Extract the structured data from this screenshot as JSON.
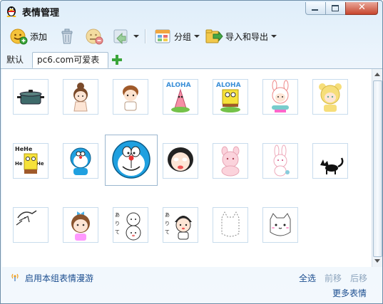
{
  "window": {
    "title": "表情管理"
  },
  "toolbar": {
    "add_label": "添加",
    "group_label": "分组",
    "import_export_label": "导入和导出"
  },
  "tabs": [
    {
      "label": "默认"
    },
    {
      "label": "pc6.com可爱表情"
    }
  ],
  "emoticons": [
    "pot",
    "girl-bun",
    "boy-brown-hair",
    "patrick-aloha",
    "spongebob-aloha",
    "bunny-hat-girl",
    "yellow-bear-girl",
    "spongebob-hehe",
    "doraemon-small",
    "doraemon-big",
    "crying-face",
    "pink-bunny",
    "pink-rabbit",
    "black-cat",
    "sketch-cat",
    "blue-bow-girl",
    "bald-baby-text",
    "girl-text",
    "white-cat-outline",
    "white-cat-cute"
  ],
  "footer": {
    "roam_label": "启用本组表情漫游",
    "select_all": "全选",
    "move_forward": "前移",
    "move_back": "后移",
    "more": "更多表情"
  },
  "colors": {
    "link": "#1a4d8f",
    "disabled": "#8da5bd",
    "accent_green": "#3aa53a"
  }
}
